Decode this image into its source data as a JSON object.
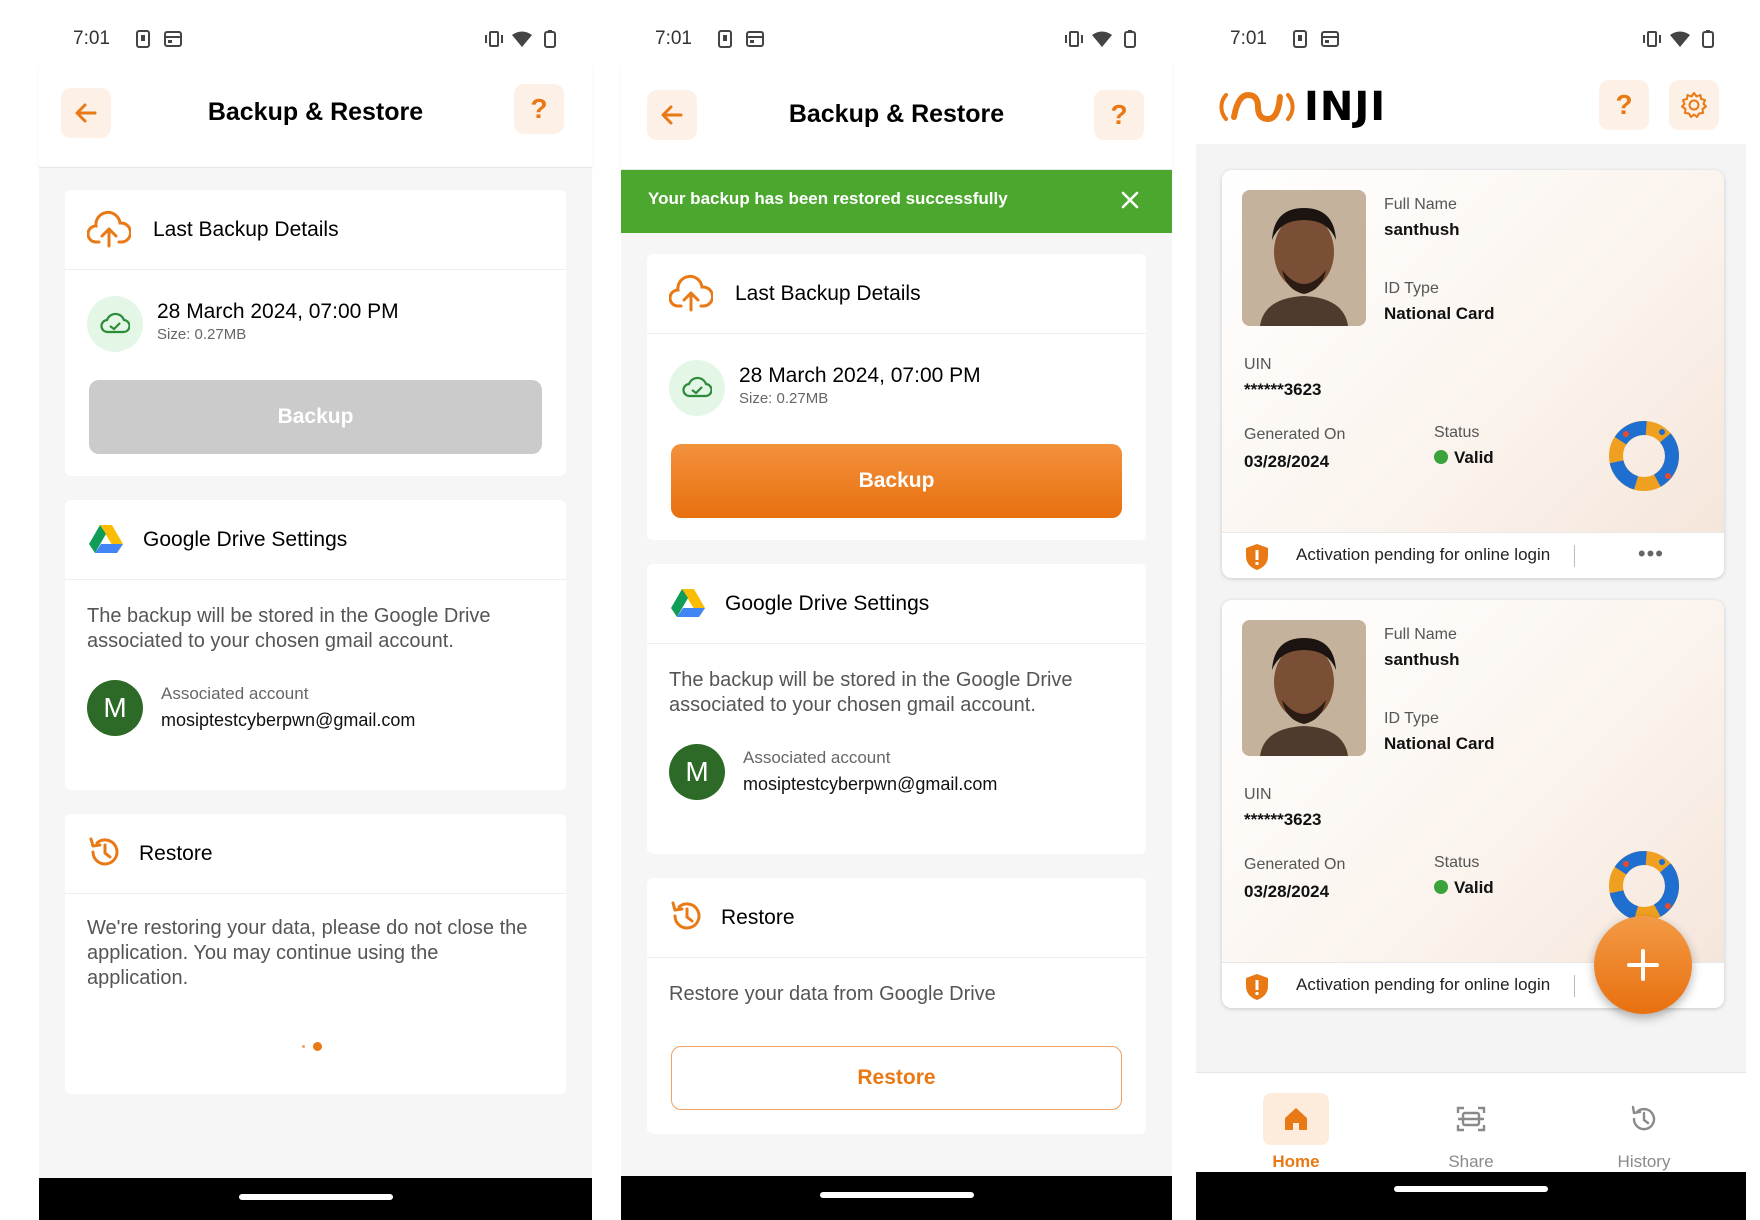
{
  "status_bar": {
    "time": "7:01"
  },
  "backup_screen": {
    "header": {
      "title": "Backup & Restore"
    },
    "last_backup": {
      "title": "Last Backup Details",
      "date": "28 March 2024, 07:00 PM",
      "size": "Size: 0.27MB",
      "backup_label": "Backup"
    },
    "drive": {
      "title": "Google Drive Settings",
      "description": "The backup will be stored in the Google Drive associated to your chosen gmail account.",
      "avatar_letter": "M",
      "account_label": "Associated account",
      "account_email": "mosiptestcyberpwn@gmail.com"
    },
    "restore": {
      "title": "Restore",
      "progress_message": "We're restoring your data, please do not close the application. You may continue using the application.",
      "description": "Restore your data from Google Drive",
      "restore_label": "Restore"
    },
    "toast": {
      "message": "Your backup has been restored successfully"
    }
  },
  "home_screen": {
    "logo_text": "INJI",
    "cards": [
      {
        "full_name_label": "Full Name",
        "full_name": "santhush",
        "id_type_label": "ID Type",
        "id_type": "National Card",
        "uin_label": "UIN",
        "uin": "******3623",
        "generated_label": "Generated On",
        "generated": "03/28/2024",
        "status_label": "Status",
        "status": "Valid",
        "footer": "Activation pending for online login",
        "more": "•••"
      },
      {
        "full_name_label": "Full Name",
        "full_name": "santhush",
        "id_type_label": "ID Type",
        "id_type": "National Card",
        "uin_label": "UIN",
        "uin": "******3623",
        "generated_label": "Generated On",
        "generated": "03/28/2024",
        "status_label": "Status",
        "status": "Valid",
        "footer": "Activation pending for online login"
      }
    ],
    "tabs": [
      {
        "label": "Home"
      },
      {
        "label": "Share"
      },
      {
        "label": "History"
      }
    ]
  },
  "colors": {
    "accent": "#e87914",
    "success": "#4ca72e",
    "avatar": "#2e6a27",
    "disabled": "#cbcbcb"
  },
  "icons": [
    "arrow-left-icon",
    "help-icon",
    "cloud-upload-icon",
    "cloud-check-icon",
    "google-drive-icon",
    "restore-history-icon",
    "close-icon",
    "gear-icon",
    "home-icon",
    "scan-icon",
    "history-icon",
    "shield-alert-icon",
    "plus-icon"
  ]
}
